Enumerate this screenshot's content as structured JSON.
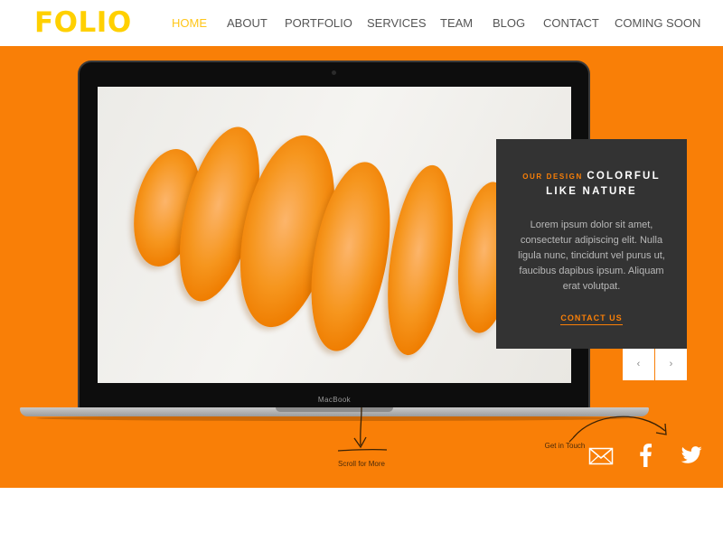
{
  "brand": {
    "logo": "FOLIO"
  },
  "nav": {
    "items": [
      {
        "label": "HOME",
        "active": true
      },
      {
        "label": "ABOUT"
      },
      {
        "label": "PORTFOLIO"
      },
      {
        "label": "SERVICES"
      },
      {
        "label": "TEAM"
      },
      {
        "label": "BLOG"
      },
      {
        "label": "CONTACT"
      },
      {
        "label": "COMING SOON"
      }
    ]
  },
  "hero": {
    "laptop_label": "MacBook",
    "card": {
      "eyebrow": "OUR DESIGN",
      "headline_line1": "COLORFUL",
      "headline_line2": "LIKE NATURE",
      "body": "Lorem ipsum dolor sit amet, consectetur adipiscing elit. Nulla ligula nunc, tincidunt vel purus ut, faucibus dapibus ipsum. Aliquam erat volutpat.",
      "cta": "CONTACT US"
    },
    "slider": {
      "prev_icon": "‹",
      "next_icon": "›"
    },
    "scroll_label": "Scroll for More",
    "touch_label": "Get in Touch"
  },
  "social": {
    "icons": [
      "mail-icon",
      "facebook-icon",
      "twitter-icon"
    ]
  },
  "colors": {
    "accent": "#f97f07",
    "logo": "#ffd000",
    "nav_active": "#ffc61a",
    "card_bg": "#333333"
  }
}
